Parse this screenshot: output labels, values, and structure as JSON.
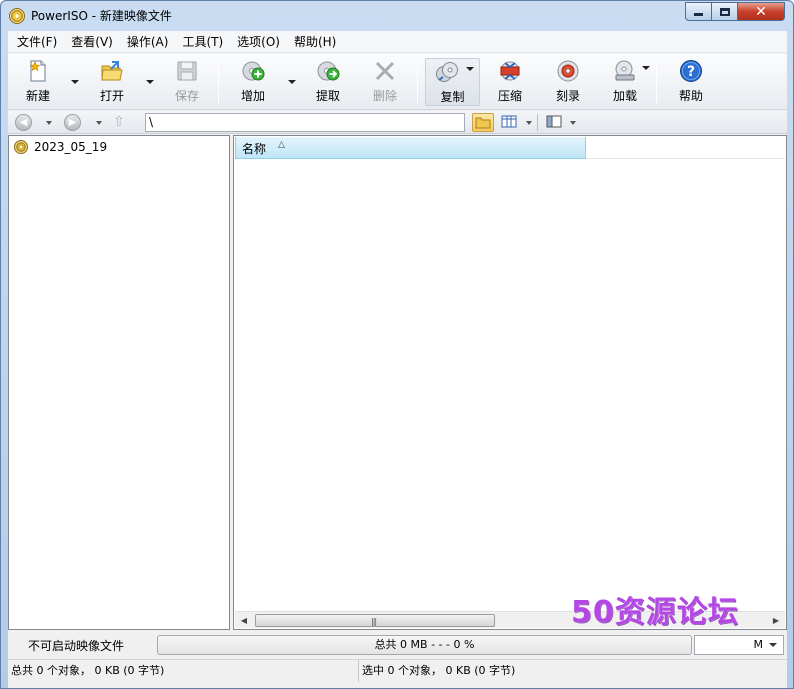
{
  "window": {
    "title": "PowerISO - 新建映像文件",
    "app_icon": "cd-disc-icon"
  },
  "menubar": {
    "items": [
      {
        "label": "文件(F)"
      },
      {
        "label": "查看(V)"
      },
      {
        "label": "操作(A)"
      },
      {
        "label": "工具(T)"
      },
      {
        "label": "选项(O)"
      },
      {
        "label": "帮助(H)"
      }
    ]
  },
  "toolbar": {
    "new": "新建",
    "open": "打开",
    "save": "保存",
    "add": "增加",
    "extract": "提取",
    "delete": "删除",
    "copy": "复制",
    "compress": "压缩",
    "burn": "刻录",
    "mount": "加载",
    "help": "帮助"
  },
  "addressbar": {
    "path": "\\"
  },
  "tree": {
    "root_label": "2023_05_19"
  },
  "filelist": {
    "column_name": "名称",
    "sort_indicator": "ascending"
  },
  "bottom": {
    "boot_label": "不可启动映像文件",
    "progress_text": "总共  0 MB   - - - 0 %",
    "progress_percent": 0,
    "capacity_text": "M"
  },
  "status": {
    "left": "总共 0 个对象， 0 KB (0 字节)",
    "right": "选中 0 个对象， 0 KB (0 字节)"
  },
  "watermark": {
    "text": "50资源论坛"
  },
  "colors": {
    "accent": "#3e7bc4",
    "header_highlight": "#bfe6f7",
    "watermark": "#b447e6"
  }
}
